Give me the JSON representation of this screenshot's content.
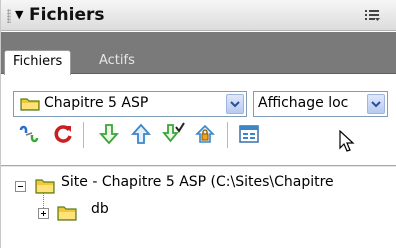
{
  "panel": {
    "title": "Fichiers"
  },
  "tabs": [
    {
      "label": "Fichiers",
      "active": true
    },
    {
      "label": "Actifs",
      "active": false
    }
  ],
  "site_select": {
    "value": "Chapitre 5 ASP"
  },
  "view_select": {
    "value": "Affichage loc"
  },
  "toolbar": {
    "icons": [
      "connect-icon",
      "refresh-icon",
      "get-files-icon",
      "put-files-icon",
      "check-out-icon",
      "check-in-icon",
      "expand-site-icon"
    ]
  },
  "tree": {
    "root_label": "Site - Chapitre 5 ASP (C:\\Sites\\Chapitre",
    "child_label": "db"
  },
  "colors": {
    "tabstrip": "#7a7a7a",
    "folder": "#f2c73a",
    "arrow_green": "#3aa53a",
    "refresh_red": "#cc1f1f"
  }
}
